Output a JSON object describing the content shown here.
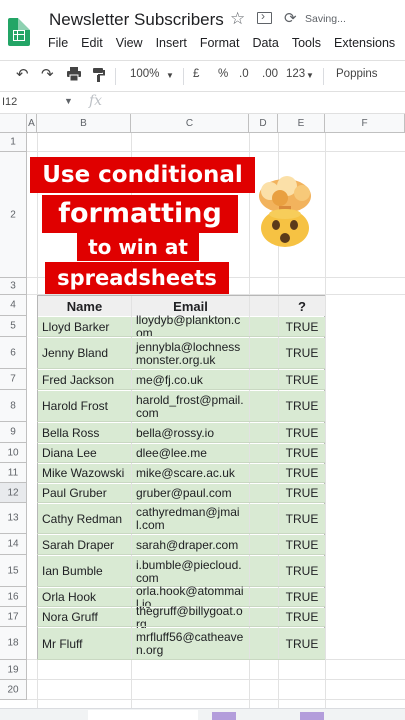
{
  "app": {
    "title": "Newsletter Subscribers",
    "saving": "Saving...",
    "menu": [
      "File",
      "Edit",
      "View",
      "Insert",
      "Format",
      "Data",
      "Tools",
      "Extensions"
    ]
  },
  "toolbar": {
    "zoom": "100%",
    "currency": "£",
    "percent": "%",
    "dec_less": ".0",
    "dec_more": ".00",
    "number_format": "123",
    "font": "Poppins"
  },
  "formula_bar": {
    "name_box": "I12",
    "fx": "fx"
  },
  "columns": [
    "A",
    "B",
    "C",
    "D",
    "E",
    "F"
  ],
  "rows": [
    "1",
    "2",
    "3",
    "4",
    "5",
    "6",
    "7",
    "8",
    "9",
    "10",
    "11",
    "12",
    "13",
    "14",
    "15",
    "16",
    "17",
    "18",
    "19",
    "20"
  ],
  "caption": {
    "line1": "Use conditional",
    "line2": "formatting",
    "line3": "to win at",
    "line4": "spreadsheets"
  },
  "table": {
    "headers": [
      "Name",
      "Email",
      "?"
    ],
    "rows": [
      {
        "name": "Lloyd Barker",
        "email": "lloydyb@plankton.com",
        "flag": "TRUE"
      },
      {
        "name": "Jenny Bland",
        "email": "jennybla@lochnessmonster.org.uk",
        "flag": "TRUE"
      },
      {
        "name": "Fred Jackson",
        "email": "me@fj.co.uk",
        "flag": "TRUE"
      },
      {
        "name": "Harold Frost",
        "email": "harold_frost@pmail.com",
        "flag": "TRUE"
      },
      {
        "name": "Bella Ross",
        "email": "bella@rossy.io",
        "flag": "TRUE"
      },
      {
        "name": "Diana Lee",
        "email": "dlee@lee.me",
        "flag": "TRUE"
      },
      {
        "name": "Mike Wazowski",
        "email": "mike@scare.ac.uk",
        "flag": "TRUE"
      },
      {
        "name": "Paul Gruber",
        "email": "gruber@paul.com",
        "flag": "TRUE"
      },
      {
        "name": "Cathy Redman",
        "email": "cathyredman@jmail.com",
        "flag": "TRUE"
      },
      {
        "name": "Sarah Draper",
        "email": "sarah@draper.com",
        "flag": "TRUE"
      },
      {
        "name": "Ian Bumble",
        "email": "i.bumble@piecloud.com",
        "flag": "TRUE"
      },
      {
        "name": "Orla Hook",
        "email": "orla.hook@atommail.io",
        "flag": "TRUE"
      },
      {
        "name": "Nora Gruff",
        "email": "thegruff@billygoat.org",
        "flag": "TRUE"
      },
      {
        "name": "Mr Fluff",
        "email": "mrfluff56@catheaven.org",
        "flag": "TRUE"
      }
    ]
  },
  "colors": {
    "highlight": "#d9ead3",
    "caption_bg": "#e00000",
    "header_bg": "#efefef",
    "sheets_green": "#23a566"
  },
  "icons": [
    "sheets-logo-icon",
    "star-icon",
    "move-to-folder-icon",
    "cloud-sync-icon",
    "undo-icon",
    "redo-icon",
    "print-icon",
    "paint-format-icon",
    "exploding-head-emoji"
  ]
}
